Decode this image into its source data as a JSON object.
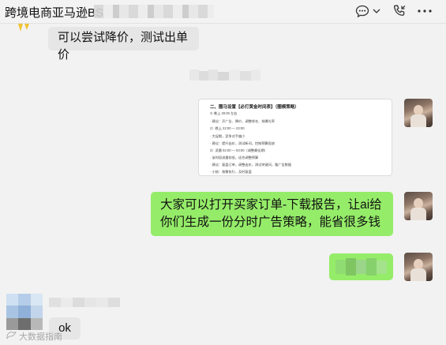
{
  "header": {
    "title": "跨境电商亚马逊BS",
    "icons": [
      "chat-bubble-icon",
      "chevron-down-icon",
      "phone-icon",
      "more-icon"
    ]
  },
  "messages": {
    "top_left_text": "可以尝试降价，测试出单价",
    "sent_image": {
      "title": "二、圈马设置【必打黄金时间表】（圈模策略）",
      "lines": [
        "① 晚上 20:00 左右",
        "· 建议：开广告、降价、调整排名、抢曝光率",
        "2）晚上 22:00 — 23:00",
        "· 大促期，竞争对手偏少",
        "· 建议：提升出价，测试新词，控制预算投放",
        "3）凌晨 02:00 — 03:00（调整最佳期）",
        "· 该时段流量较低，适合调整预算",
        "· 建议：复盘订单，调整出价，测试关键词，看广告数据",
        "· 小结：按需执行，及时复盘"
      ]
    },
    "green_text": "大家可以打开买家订单-下载报告，让ai给你们生成一份分时广告策略，能省很多钱",
    "ok_text": "ok"
  },
  "watermark": {
    "text": "大数据指南"
  },
  "colors": {
    "bubble_green": "#95ec69",
    "bubble_gray": "#e6e6e6",
    "chat_bg": "#f2f2f2"
  }
}
